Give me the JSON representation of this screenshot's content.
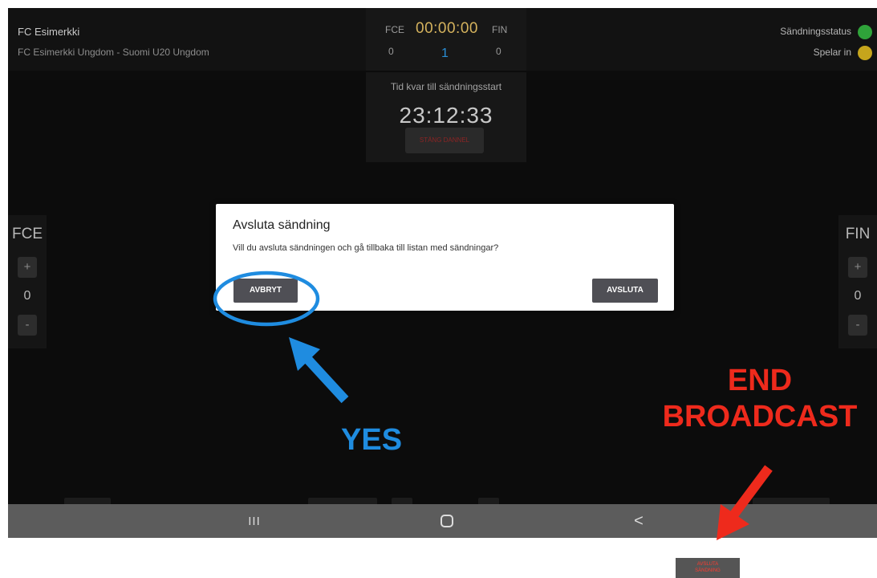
{
  "header": {
    "team_name": "FC Esimerkki",
    "match_name": "FC Esimerkki Ungdom - Suomi U20 Ungdom",
    "scoreboard": {
      "home_abbr": "FCE",
      "clock": "00:00:00",
      "away_abbr": "FIN",
      "home_score": "0",
      "period": "1",
      "away_score": "0"
    },
    "broadcast_status_label": "Sändningsstatus",
    "recording_label": "Spelar in",
    "broadcast_status_color": "#2fa33a",
    "recording_color": "#c6a51c"
  },
  "countdown": {
    "label": "Tid kvar till sändningsstart",
    "time": "23:12:33",
    "button_label": "STÄNG DANNEL"
  },
  "home_panel": {
    "abbr": "FCE",
    "plus": "+",
    "score": "0",
    "minus": "-"
  },
  "away_panel": {
    "abbr": "FIN",
    "plus": "+",
    "score": "0",
    "minus": "-"
  },
  "dialog": {
    "title": "Avsluta sändning",
    "message": "Vill du avsluta sändningen och gå tillbaka till listan med sändningar?",
    "cancel_label": "AVBRYT",
    "confirm_label": "AVSLUTA"
  },
  "navbar": {
    "recents_icon": "recents-icon",
    "home_icon": "home-icon",
    "back_icon": "back-icon",
    "recents_glyph": "III",
    "back_glyph": "<"
  },
  "annotations": {
    "yes_text": "YES",
    "end_text_line1": "END",
    "end_text_line2": "BROADCAST",
    "yes_color": "#1f8ce0",
    "end_color": "#ee2a1c",
    "end_button_label_line1": "AVSLUTA",
    "end_button_label_line2": "SÄNDNING"
  }
}
